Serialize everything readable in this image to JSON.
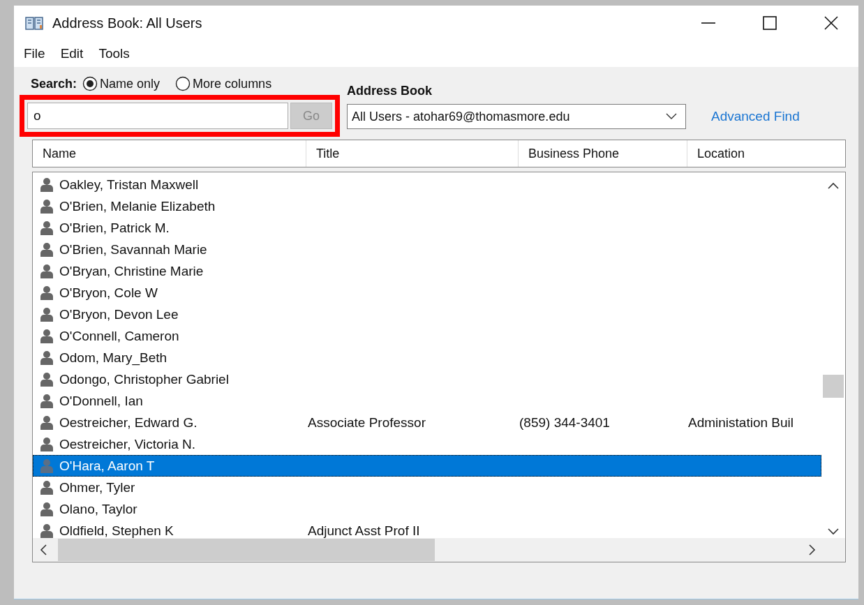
{
  "window": {
    "title": "Address Book: All Users"
  },
  "menu": [
    "File",
    "Edit",
    "Tools"
  ],
  "search": {
    "label": "Search:",
    "highlighted": true,
    "value": "o",
    "go": "Go",
    "go_disabled": true,
    "options": [
      {
        "label": "Name only",
        "selected": true
      },
      {
        "label": "More columns",
        "selected": false
      }
    ]
  },
  "address_book": {
    "label": "Address Book",
    "value": "All Users - atohar69@thomasmore.edu"
  },
  "advanced_find": "Advanced Find",
  "table": {
    "columns": [
      "Name",
      "Title",
      "Business Phone",
      "Location"
    ],
    "rows": [
      {
        "name": "Oakley, Tristan Maxwell",
        "title": "",
        "phone": "",
        "location": "",
        "selected": false
      },
      {
        "name": "O'Brien, Melanie Elizabeth",
        "title": "",
        "phone": "",
        "location": "",
        "selected": false
      },
      {
        "name": "O'Brien, Patrick M.",
        "title": "",
        "phone": "",
        "location": "",
        "selected": false
      },
      {
        "name": "O'Brien, Savannah Marie",
        "title": "",
        "phone": "",
        "location": "",
        "selected": false
      },
      {
        "name": "O'Bryan, Christine Marie",
        "title": "",
        "phone": "",
        "location": "",
        "selected": false
      },
      {
        "name": "O'Bryon, Cole W",
        "title": "",
        "phone": "",
        "location": "",
        "selected": false
      },
      {
        "name": "O'Bryon, Devon Lee",
        "title": "",
        "phone": "",
        "location": "",
        "selected": false
      },
      {
        "name": "O'Connell, Cameron",
        "title": "",
        "phone": "",
        "location": "",
        "selected": false
      },
      {
        "name": "Odom, Mary_Beth",
        "title": "",
        "phone": "",
        "location": "",
        "selected": false
      },
      {
        "name": "Odongo, Christopher Gabriel",
        "title": "",
        "phone": "",
        "location": "",
        "selected": false
      },
      {
        "name": "O'Donnell, Ian",
        "title": "",
        "phone": "",
        "location": "",
        "selected": false
      },
      {
        "name": "Oestreicher, Edward G.",
        "title": "Associate Professor",
        "phone": "(859) 344-3401",
        "location": "Administation Buil",
        "selected": false
      },
      {
        "name": "Oestreicher, Victoria N.",
        "title": "",
        "phone": "",
        "location": "",
        "selected": false
      },
      {
        "name": "O'Hara, Aaron T",
        "title": "",
        "phone": "",
        "location": "",
        "selected": true
      },
      {
        "name": "Ohmer, Tyler",
        "title": "",
        "phone": "",
        "location": "",
        "selected": false
      },
      {
        "name": "Olano, Taylor",
        "title": "",
        "phone": "",
        "location": "",
        "selected": false
      },
      {
        "name": "Oldfield, Stephen K",
        "title": "Adjunct Asst Prof II",
        "phone": "",
        "location": "",
        "selected": false
      }
    ]
  }
}
